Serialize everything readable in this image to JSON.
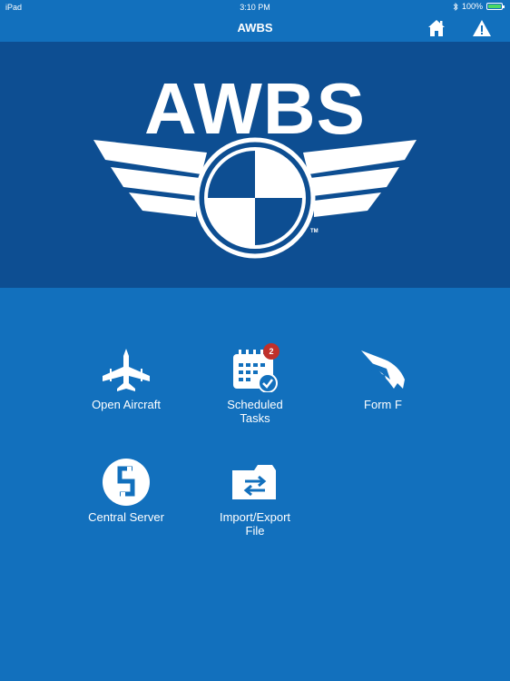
{
  "status_bar": {
    "device": "iPad",
    "time": "3:10 PM",
    "battery": "100%",
    "bluetooth_icon": "bluetooth-icon"
  },
  "nav": {
    "title": "AWBS",
    "home_icon": "home-icon",
    "alert_icon": "warning-icon"
  },
  "banner": {
    "logo_text": "AWBS",
    "trademark": "TM"
  },
  "menu": [
    {
      "label": "Open Aircraft",
      "icon": "jet-icon"
    },
    {
      "label": "Scheduled\nTasks",
      "icon": "calendar-check-icon",
      "badge": "2"
    },
    {
      "label": "Form F",
      "icon": "wing-icon"
    },
    {
      "label": "Central Server",
      "icon": "server-s-icon"
    },
    {
      "label": "Import/Export\nFile",
      "icon": "folder-transfer-icon"
    }
  ],
  "colors": {
    "background": "#1270bd",
    "banner": "#0d4e92",
    "badge": "#c0302b",
    "battery": "#4cd964"
  }
}
